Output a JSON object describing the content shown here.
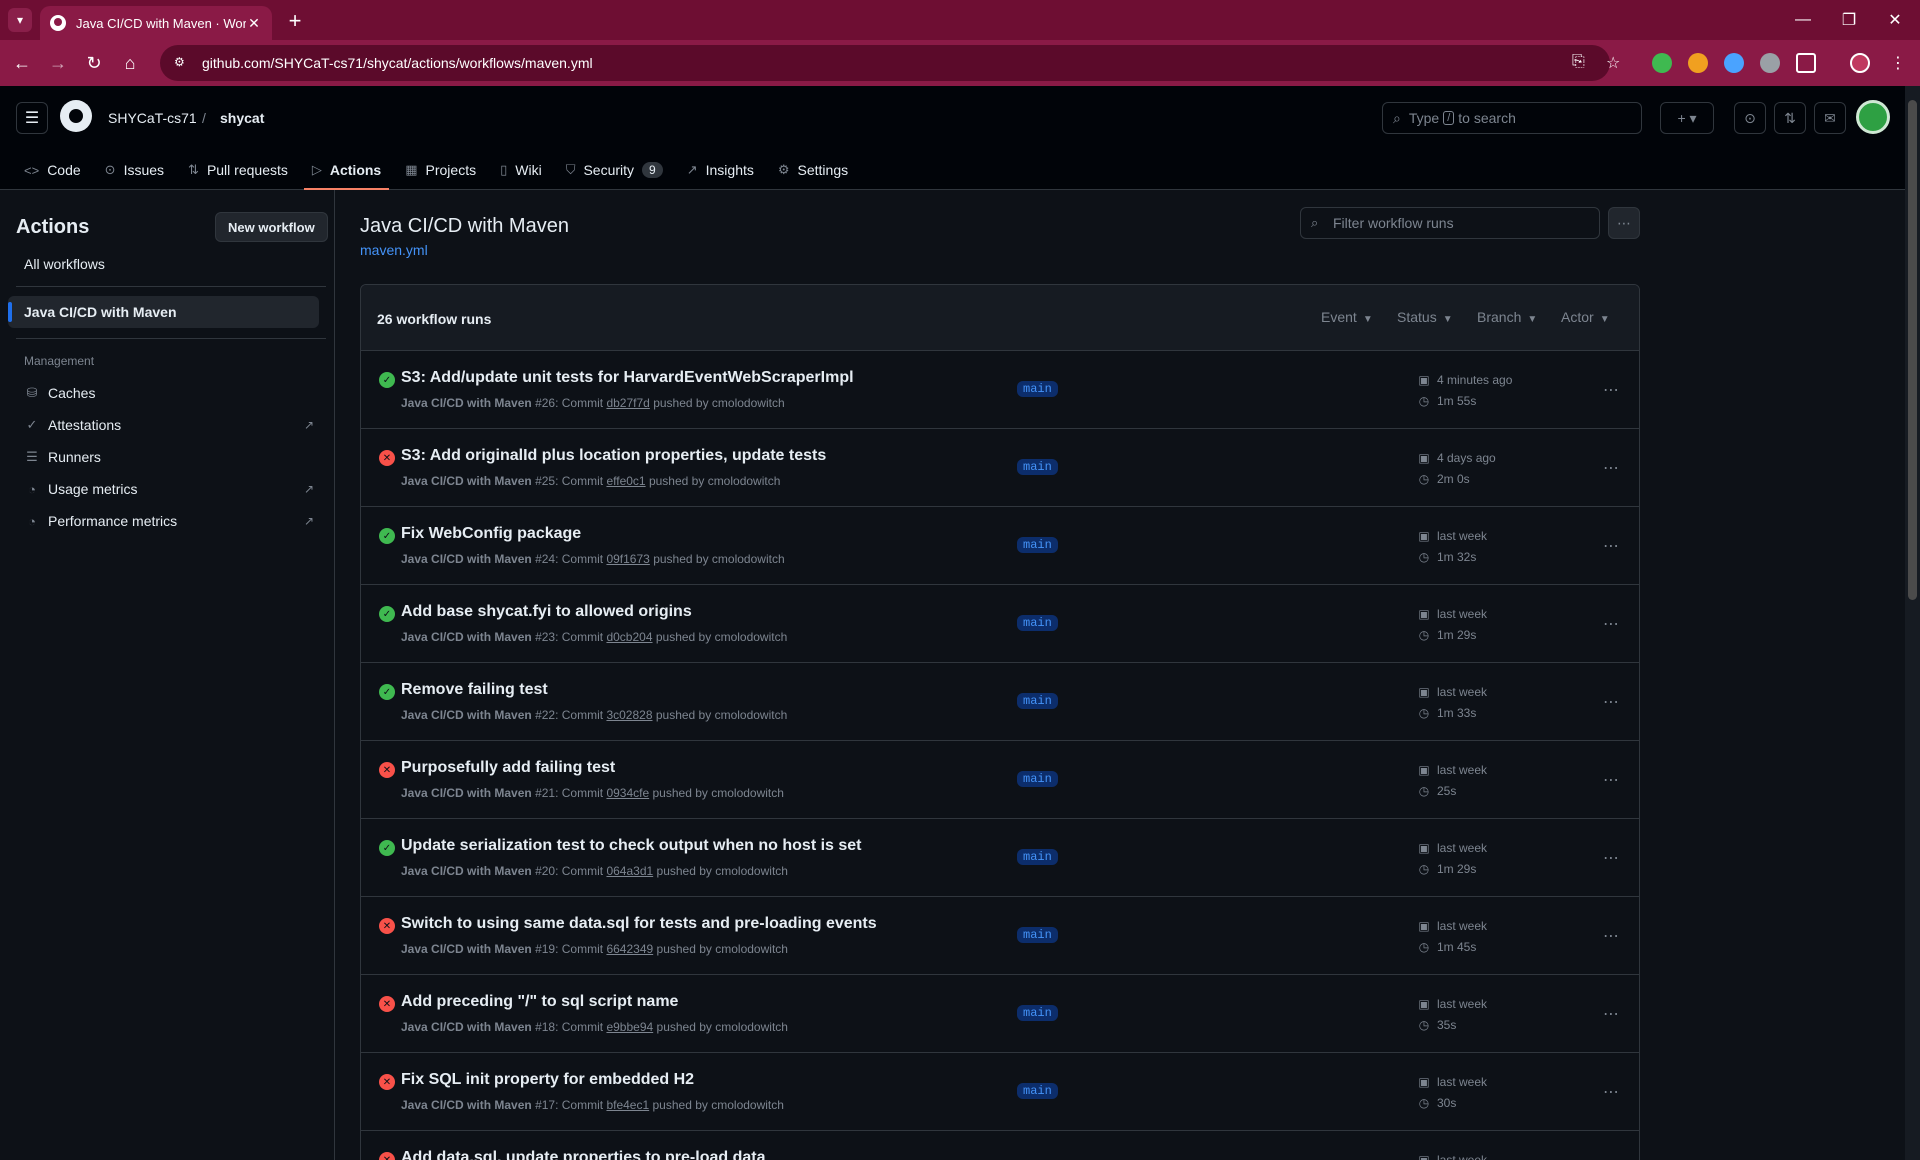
{
  "browser": {
    "tab_title": "Java CI/CD with Maven · Workfl",
    "url": "github.com/SHYCaT-cs71/shycat/actions/workflows/maven.yml",
    "accent": "#6e0e33"
  },
  "header": {
    "owner": "SHYCaT-cs71",
    "separator": "/",
    "repo": "shycat",
    "search_label": "Type",
    "search_key": "/",
    "search_suffix": "to search"
  },
  "repo_nav": [
    {
      "label": "Code",
      "icon": "code-icon"
    },
    {
      "label": "Issues",
      "icon": "issue-icon"
    },
    {
      "label": "Pull requests",
      "icon": "pull-request-icon"
    },
    {
      "label": "Actions",
      "icon": "play-icon"
    },
    {
      "label": "Projects",
      "icon": "table-icon"
    },
    {
      "label": "Wiki",
      "icon": "book-icon"
    },
    {
      "label": "Security",
      "icon": "shield-icon",
      "count": "9"
    },
    {
      "label": "Insights",
      "icon": "graph-icon"
    },
    {
      "label": "Settings",
      "icon": "gear-icon"
    }
  ],
  "sidebar": {
    "title": "Actions",
    "new_workflow": "New workflow",
    "all_workflows": "All workflows",
    "active_workflow": "Java CI/CD with Maven",
    "management_heading": "Management",
    "management": [
      {
        "label": "Caches",
        "icon": "cache-icon",
        "external": false
      },
      {
        "label": "Attestations",
        "icon": "verified-icon",
        "external": true
      },
      {
        "label": "Runners",
        "icon": "server-icon",
        "external": false
      },
      {
        "label": "Usage metrics",
        "icon": "meter-icon",
        "external": true
      },
      {
        "label": "Performance metrics",
        "icon": "meter-icon",
        "external": true
      }
    ]
  },
  "main": {
    "title": "Java CI/CD with Maven",
    "file": "maven.yml",
    "filter_placeholder": "Filter workflow runs",
    "runs_count": "26 workflow runs",
    "filters": [
      "Event",
      "Status",
      "Branch",
      "Actor"
    ]
  },
  "runs": [
    {
      "status": "success",
      "title": "S3: Add/update unit tests for HarvardEventWebScraperImpl",
      "workflow": "Java CI/CD with Maven",
      "number": "#26",
      "sha": "db27f7d",
      "actor": "cmolodowitch",
      "branch": "main",
      "when": "4 minutes ago",
      "duration": "1m 55s"
    },
    {
      "status": "failure",
      "title": "S3: Add originalId plus location properties, update tests",
      "workflow": "Java CI/CD with Maven",
      "number": "#25",
      "sha": "effe0c1",
      "actor": "cmolodowitch",
      "branch": "main",
      "when": "4 days ago",
      "duration": "2m 0s"
    },
    {
      "status": "success",
      "title": "Fix WebConfig package",
      "workflow": "Java CI/CD with Maven",
      "number": "#24",
      "sha": "09f1673",
      "actor": "cmolodowitch",
      "branch": "main",
      "when": "last week",
      "duration": "1m 32s"
    },
    {
      "status": "success",
      "title": "Add base shycat.fyi to allowed origins",
      "workflow": "Java CI/CD with Maven",
      "number": "#23",
      "sha": "d0cb204",
      "actor": "cmolodowitch",
      "branch": "main",
      "when": "last week",
      "duration": "1m 29s"
    },
    {
      "status": "success",
      "title": "Remove failing test",
      "workflow": "Java CI/CD with Maven",
      "number": "#22",
      "sha": "3c02828",
      "actor": "cmolodowitch",
      "branch": "main",
      "when": "last week",
      "duration": "1m 33s"
    },
    {
      "status": "failure",
      "title": "Purposefully add failing test",
      "workflow": "Java CI/CD with Maven",
      "number": "#21",
      "sha": "0934cfe",
      "actor": "cmolodowitch",
      "branch": "main",
      "when": "last week",
      "duration": "25s"
    },
    {
      "status": "success",
      "title": "Update serialization test to check output when no host is set",
      "workflow": "Java CI/CD with Maven",
      "number": "#20",
      "sha": "064a3d1",
      "actor": "cmolodowitch",
      "branch": "main",
      "when": "last week",
      "duration": "1m 29s"
    },
    {
      "status": "failure",
      "title": "Switch to using same data.sql for tests and pre-loading events",
      "workflow": "Java CI/CD with Maven",
      "number": "#19",
      "sha": "6642349",
      "actor": "cmolodowitch",
      "branch": "main",
      "when": "last week",
      "duration": "1m 45s"
    },
    {
      "status": "failure",
      "title": "Add preceding \"/\" to sql script name",
      "workflow": "Java CI/CD with Maven",
      "number": "#18",
      "sha": "e9bbe94",
      "actor": "cmolodowitch",
      "branch": "main",
      "when": "last week",
      "duration": "35s"
    },
    {
      "status": "failure",
      "title": "Fix SQL init property for embedded H2",
      "workflow": "Java CI/CD with Maven",
      "number": "#17",
      "sha": "bfe4ec1",
      "actor": "cmolodowitch",
      "branch": "main",
      "when": "last week",
      "duration": "30s"
    },
    {
      "status": "failure",
      "title": "Add data.sql, update properties to pre-load data",
      "workflow": "Java CI/CD with Maven",
      "number": "",
      "sha": "",
      "actor": "",
      "branch": "",
      "when": "last week",
      "duration": ""
    }
  ],
  "labels": {
    "commit": "Commit",
    "pushed_by": "pushed by"
  }
}
